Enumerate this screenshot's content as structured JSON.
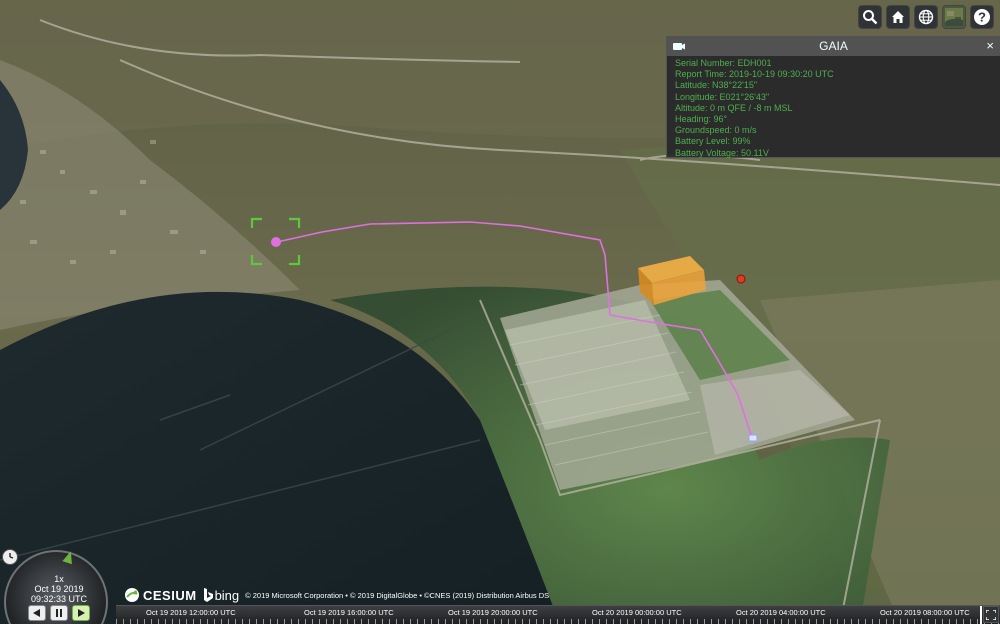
{
  "toolbar": {
    "buttons": [
      {
        "name": "search-button",
        "icon": "magnifier-icon"
      },
      {
        "name": "home-button",
        "icon": "house-icon"
      },
      {
        "name": "scene-mode-button",
        "icon": "globe-icon"
      },
      {
        "name": "base-layer-picker-button",
        "icon": "imagery-icon"
      },
      {
        "name": "help-button",
        "icon": "question-icon"
      }
    ]
  },
  "infobox": {
    "title": "GAIA",
    "close": "×",
    "lines": [
      "Serial Number: EDH001",
      "Report Time: 2019-10-19 09:30:20 UTC",
      "Latitude: N38°22'15\"",
      "Longitude: E021°26'43\"",
      "Altitude: 0 m QFE / -8 m MSL",
      "Heading: 96°",
      "Groundspeed: 0 m/s",
      "Battery Level: 99%",
      "Battery Voltage: 50.11V"
    ]
  },
  "animation": {
    "speed": "1x",
    "date": "Oct 19 2019",
    "time": "09:32:33 UTC"
  },
  "credits": {
    "cesium": "CESIUM",
    "bing": "bing",
    "text": "© 2019 Microsoft Corporation • © 2019 DigitalGlobe • ©CNES (2019) Distribution Airbus DS"
  },
  "timeline": {
    "labels": [
      "Oct 19 2019 12:00:00 UTC",
      "Oct 19 2019 16:00:00 UTC",
      "Oct 19 2019 20:00:00 UTC",
      "Oct 20 2019 00:00:00 UTC",
      "Oct 20 2019 04:00:00 UTC",
      "Oct 20 2019 08:00:00 UTC"
    ]
  },
  "colors": {
    "flight_path": "#e070e0",
    "target_marker": "#5ec83a",
    "geofence_volume": "#f0a030",
    "info_text": "#4db04d"
  }
}
